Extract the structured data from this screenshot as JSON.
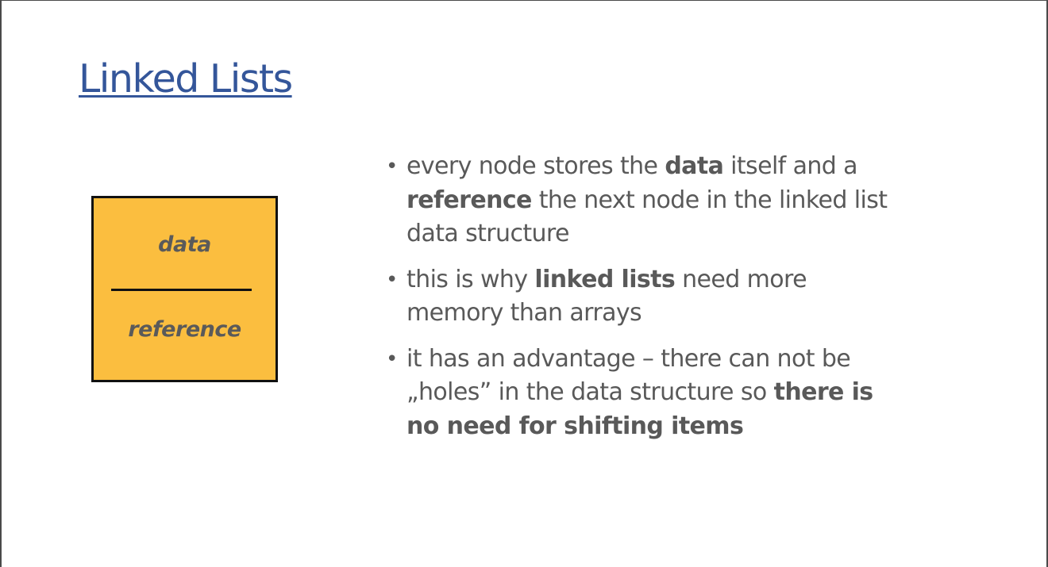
{
  "slide": {
    "title": "Linked Lists"
  },
  "node": {
    "data_label": "data",
    "reference_label": "reference",
    "fill_color": "#fbbe3f"
  },
  "bullets": [
    {
      "l1_a": "every node stores the ",
      "l1_b": "data",
      "l1_c": " itself and a",
      "l2_a": "reference",
      "l2_b": " the next node in the linked list",
      "l3": "data structure"
    },
    {
      "l1_a": "this is why ",
      "l1_b": "linked lists",
      "l1_c": " need more",
      "l2": "memory than arrays"
    },
    {
      "l1": "it has an advantage – there can not be",
      "l2_a": "„holes” in the data structure so ",
      "l2_b": "there is",
      "l3": "no need for shifting items"
    }
  ],
  "colors": {
    "title": "#34569a",
    "text": "#595959"
  }
}
